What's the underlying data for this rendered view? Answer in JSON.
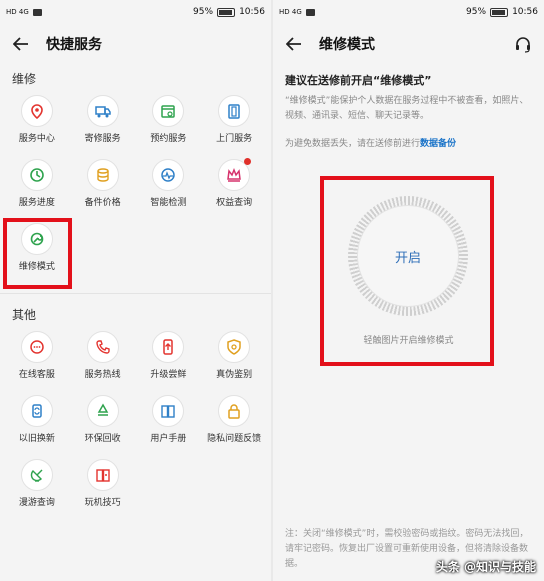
{
  "status": {
    "left_icons": "HD 4G",
    "battery_pct": "95%",
    "time": "10:56"
  },
  "left": {
    "title": "快捷服务",
    "sections": [
      {
        "title": "维修",
        "items": [
          {
            "label": "服务中心",
            "icon": "location-pin-icon",
            "color": "#e3342f"
          },
          {
            "label": "寄修服务",
            "icon": "truck-icon",
            "color": "#2f80c8"
          },
          {
            "label": "预约服务",
            "icon": "calendar-icon",
            "color": "#2fa34e"
          },
          {
            "label": "上门服务",
            "icon": "door-icon",
            "color": "#2f80c8"
          },
          {
            "label": "服务进度",
            "icon": "progress-icon",
            "color": "#2fa34e"
          },
          {
            "label": "备件价格",
            "icon": "coins-icon",
            "color": "#e0a020"
          },
          {
            "label": "智能检测",
            "icon": "diagnose-icon",
            "color": "#2f80c8"
          },
          {
            "label": "权益查询",
            "icon": "crown-icon",
            "color": "#d6336c",
            "badge": true
          },
          {
            "label": "维修模式",
            "icon": "maintenance-icon",
            "color": "#2fa34e"
          }
        ]
      },
      {
        "title": "其他",
        "items": [
          {
            "label": "在线客服",
            "icon": "chat-icon",
            "color": "#e3342f"
          },
          {
            "label": "服务热线",
            "icon": "phone-icon",
            "color": "#e3342f"
          },
          {
            "label": "升级尝鲜",
            "icon": "upgrade-icon",
            "color": "#e3342f"
          },
          {
            "label": "真伪鉴别",
            "icon": "verify-icon",
            "color": "#e0a020"
          },
          {
            "label": "以旧换新",
            "icon": "trade-in-icon",
            "color": "#2f80c8"
          },
          {
            "label": "环保回收",
            "icon": "recycle-icon",
            "color": "#2fa34e"
          },
          {
            "label": "用户手册",
            "icon": "manual-icon",
            "color": "#2f80c8"
          },
          {
            "label": "隐私问题反馈",
            "icon": "privacy-lock-icon",
            "color": "#e0a020"
          },
          {
            "label": "漫游查询",
            "icon": "satellite-icon",
            "color": "#2fa34e"
          },
          {
            "label": "玩机技巧",
            "icon": "tips-book-icon",
            "color": "#e3342f"
          }
        ]
      }
    ]
  },
  "right": {
    "title": "维修模式",
    "main_title": "建议在送修前开启“维修模式”",
    "description": "“维修模式”能保护个人数据在服务过程中不被查看，如照片、视频、通讯录、短信、聊天记录等。",
    "backup_note": "为避免数据丢失，请在送修前进行",
    "backup_link": "数据备份",
    "start_label": "开启",
    "tap_hint": "轻触图片开启维修模式",
    "footer_note": "注：关闭“维修模式”时，需校验密码或指纹。密码无法找回，请牢记密码。恢复出厂设置可重新使用设备，但将清除设备数据。"
  },
  "watermark": "头条 @知识与技能",
  "colors": {
    "highlight": "#e3101a",
    "link": "#1a73c8"
  }
}
